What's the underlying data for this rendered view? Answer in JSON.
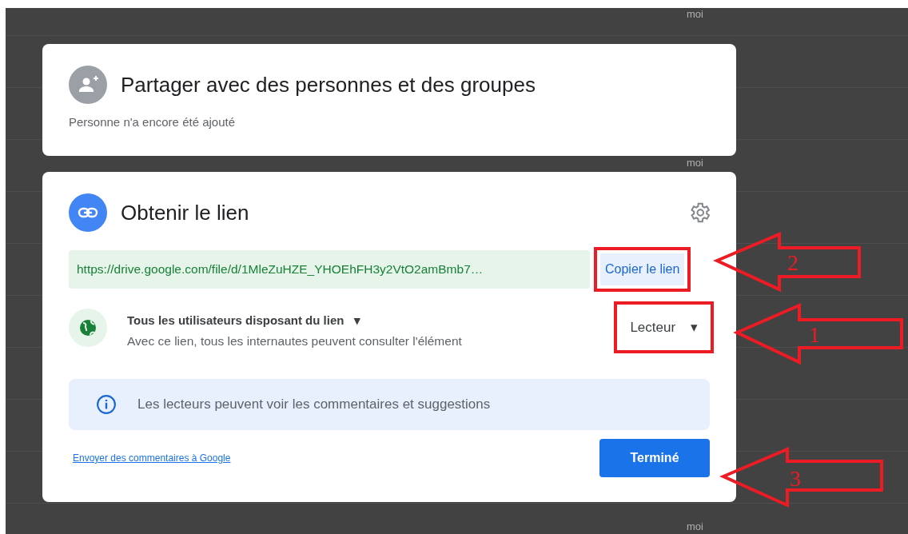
{
  "background_rows": [
    {
      "label": "moi"
    },
    {
      "label": "moi"
    },
    {
      "label": "moi"
    }
  ],
  "share_card": {
    "title": "Partager avec des personnes et des groupes",
    "subtitle": "Personne n'a encore été ajouté"
  },
  "link_card": {
    "title": "Obtenir le lien",
    "url": "https://drive.google.com/file/d/1MleZuHZE_YHOEhFH3y2VtO2amBmb7…",
    "copy_button": {
      "label": "Copier le lien",
      "highlighted": true
    },
    "access": {
      "scope": "Tous les utilisateurs disposant du lien",
      "caret": "▾",
      "description": "Avec ce lien, tous les internautes peuvent consulter l'élément"
    },
    "role": {
      "label": "Lecteur",
      "caret": "▾",
      "highlighted": true
    },
    "info": "Les lecteurs peuvent voir les commentaires et suggestions",
    "feedback_link": "Envoyer des commentaires à Google",
    "done_button": "Terminé"
  },
  "annotations": [
    {
      "label": "2"
    },
    {
      "label": "1"
    },
    {
      "label": "3"
    }
  ]
}
